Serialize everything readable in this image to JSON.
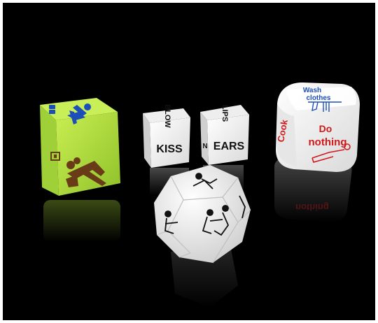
{
  "scene": {
    "background_color": "#000000",
    "frame_color": "#ffffff"
  },
  "dice": {
    "green": {
      "color": "#b6e23a",
      "ink": "#1d4fb8",
      "ink_dark": "#6a3b17",
      "icon": "couple-pose-icons"
    },
    "words_left": {
      "front": "KISS",
      "top": "BLOW",
      "ink": "#111111"
    },
    "words_right": {
      "front": "EARS",
      "top": "LIPS",
      "left_edge": "N",
      "ink": "#111111"
    },
    "action": {
      "front_line1": "Do",
      "front_line2": "nothing",
      "top_line1": "Wash",
      "top_line2": "clothes",
      "side": "Cook",
      "ink_red": "#d0191b",
      "ink_blue": "#1d4fb8"
    },
    "dodecahedron": {
      "color": "#f4f4f4",
      "icon": "figure-pose-icons"
    }
  }
}
